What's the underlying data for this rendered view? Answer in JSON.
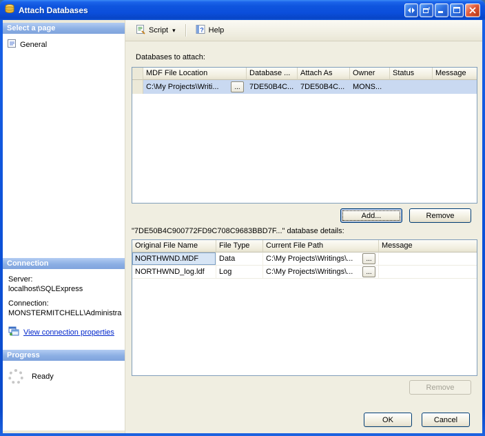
{
  "window": {
    "title": "Attach Databases"
  },
  "sidebar": {
    "select_page_header": "Select a page",
    "pages": [
      {
        "label": "General"
      }
    ],
    "connection": {
      "header": "Connection",
      "server_label": "Server:",
      "server_value": "localhost\\SQLExpress",
      "connection_label": "Connection:",
      "connection_value": "MONSTERMITCHELL\\Administra",
      "link_label": "View connection properties"
    },
    "progress": {
      "header": "Progress",
      "status": "Ready"
    }
  },
  "toolbar": {
    "script_label": "Script",
    "help_label": "Help"
  },
  "icons": {
    "dropdown_arrow": "▾",
    "browse_label": "..."
  },
  "main": {
    "databases_label": "Databases to attach:",
    "databases_table": {
      "columns": [
        "",
        "MDF File Location",
        "Database ...",
        "Attach As",
        "Owner",
        "Status",
        "Message"
      ],
      "rows": [
        {
          "mdf_file_location": "C:\\My Projects\\Writi...",
          "database": "7DE50B4C...",
          "attach_as": "7DE50B4C...",
          "owner": "MONS...",
          "status": "",
          "message": ""
        }
      ]
    },
    "add_button": "Add...",
    "remove_button": "Remove",
    "details_label": "\"7DE50B4C900772FD9C708C9683BBD7F...\" database details:",
    "details_table": {
      "columns": [
        "Original File Name",
        "File Type",
        "Current File Path",
        "Message"
      ],
      "rows": [
        {
          "original_file_name": "NORTHWND.MDF",
          "file_type": "Data",
          "current_file_path": "C:\\My Projects\\Writings\\...",
          "message": ""
        },
        {
          "original_file_name": "NORTHWND_log.ldf",
          "file_type": "Log",
          "current_file_path": "C:\\My Projects\\Writings\\...",
          "message": ""
        }
      ]
    },
    "details_remove_button": "Remove",
    "ok_button": "OK",
    "cancel_button": "Cancel"
  }
}
